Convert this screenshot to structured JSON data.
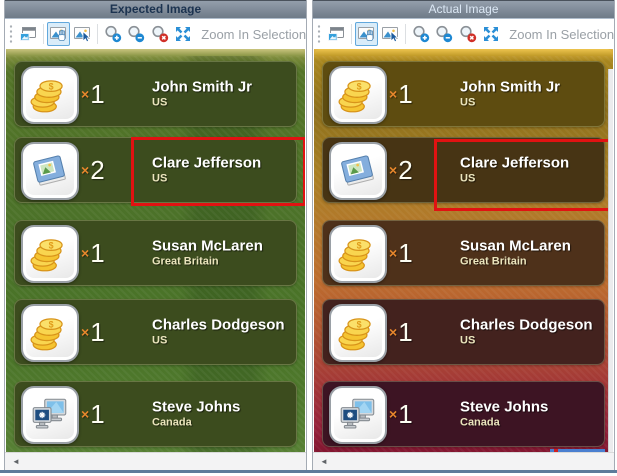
{
  "panels": [
    {
      "id": "expected",
      "title": "Expected Image"
    },
    {
      "id": "actual",
      "title": "Actual Image"
    }
  ],
  "toolbar": {
    "zoom_in_selection_label": "Zoom In Selection",
    "buttons": [
      {
        "name": "open-image-in-window"
      },
      {
        "name": "pan-mode",
        "selected": true
      },
      {
        "name": "selection-mode"
      },
      {
        "name": "zoom-in"
      },
      {
        "name": "zoom-out"
      },
      {
        "name": "zoom-reset"
      },
      {
        "name": "zoom-fit"
      }
    ]
  },
  "count_prefix": "×",
  "people": [
    {
      "icon": "coins",
      "count": "1",
      "name": "John Smith Jr",
      "country": "US",
      "highlighted": false
    },
    {
      "icon": "album",
      "count": "2",
      "name": "Clare Jefferson",
      "country": "US",
      "highlighted": true
    },
    {
      "icon": "coins",
      "count": "1",
      "name": "Susan McLaren",
      "country": "Great Britain",
      "highlighted": false
    },
    {
      "icon": "coins",
      "count": "1",
      "name": "Charles Dodgeson",
      "country": "US",
      "highlighted": false
    },
    {
      "icon": "computers",
      "count": "1",
      "name": "Steve Johns",
      "country": "Canada",
      "highlighted": false
    }
  ],
  "icons": {
    "scroll_left_arrow": "◄",
    "row_icon_names": [
      "coins-icon",
      "photo-album-icon",
      "coins-icon",
      "coins-icon",
      "networked-computers-icon"
    ]
  },
  "colors": {
    "header_bg_top": "#939eab",
    "header_bg_bottom": "#6f7b88",
    "expected_title_text": "#1c3350",
    "actual_title_text": "#dbe7f4",
    "toolbar_selected_border": "#62a8dc",
    "toolbar_selected_bg": "#d9ecf9",
    "toolbar_label_text": "#9aa0a6",
    "zoom_badge_blue": "#1e88d2",
    "zoom_badge_red": "#d03028",
    "fit_icon_blue": "#2b8fd6",
    "highlight_rect": "#e11212",
    "count_sign_orange": "#e8872c",
    "name_text": "#ffffff",
    "country_text": "#ebe5bd",
    "expected_row_bg": "#3c4c1e",
    "actual_row_bgs": [
      "#5e4c10",
      "#473414",
      "#4e311a",
      "#43221e",
      "#3d1423"
    ],
    "expected_bg_base": "#4b7229",
    "actual_bg_top": "#d8ae3a",
    "actual_bg_bottom": "#7e1430",
    "window_bottom_border": "#5d7b9a"
  }
}
